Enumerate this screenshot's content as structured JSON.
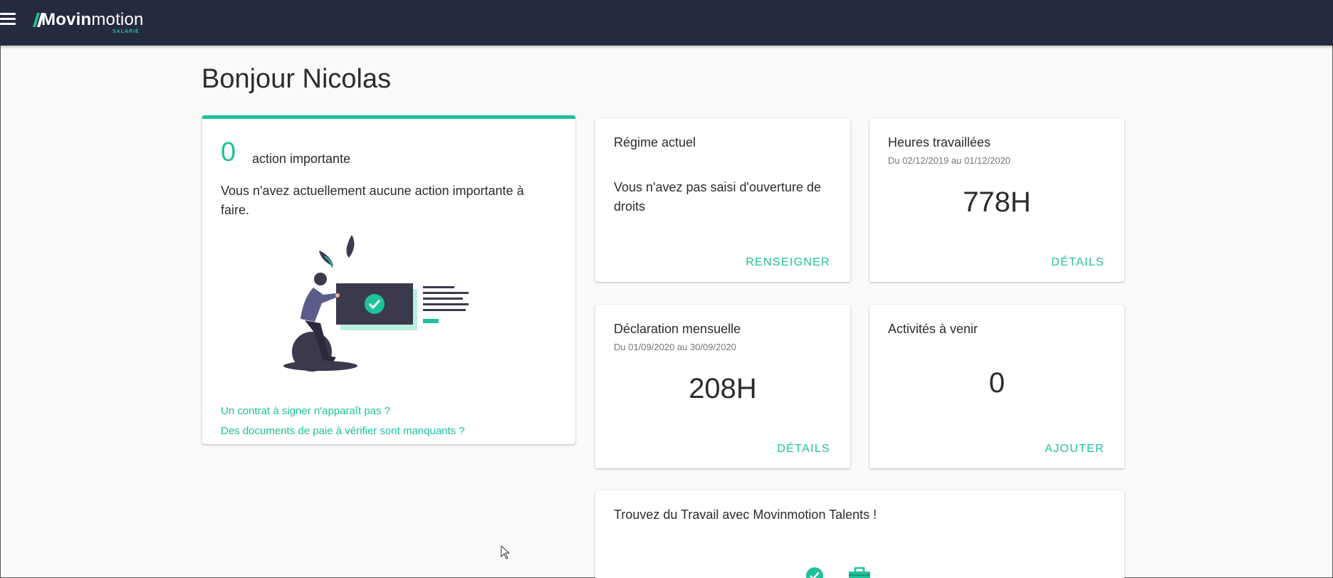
{
  "header": {
    "logo_bold": "Movin",
    "logo_light": "motion",
    "logo_sub": "SALARIÉ"
  },
  "greeting": "Bonjour Nicolas",
  "actions_card": {
    "count": "0",
    "count_label": "action importante",
    "message": "Vous n'avez actuellement aucune action importante à faire.",
    "links": [
      "Un contrat à signer n'apparaît pas ?",
      "Des documents de paie à vérifier sont manquants ?"
    ]
  },
  "regime_card": {
    "title": "Régime actuel",
    "text": "Vous n'avez pas saisi d'ouverture de droits",
    "action": "RENSEIGNER"
  },
  "hours_card": {
    "title": "Heures travaillées",
    "period": "Du 02/12/2019 au 01/12/2020",
    "value": "778H",
    "action": "DÉTAILS"
  },
  "declaration_card": {
    "title": "Déclaration mensuelle",
    "period": "Du 01/09/2020 au 30/09/2020",
    "value": "208H",
    "action": "DÉTAILS"
  },
  "activities_card": {
    "title": "Activités à venir",
    "value": "0",
    "action": "AJOUTER"
  },
  "talents_card": {
    "title": "Trouvez du Travail avec Movinmotion Talents !"
  },
  "colors": {
    "accent": "#1ec29a",
    "topbar": "#252b3f"
  }
}
